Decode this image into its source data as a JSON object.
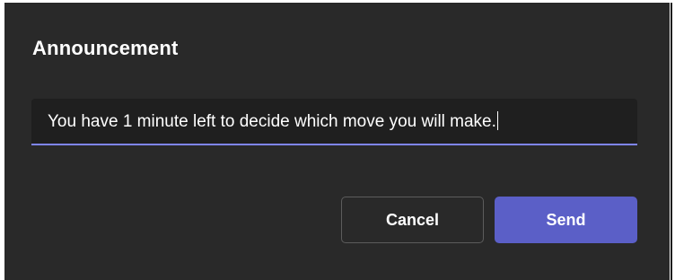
{
  "dialog": {
    "title": "Announcement",
    "input": {
      "value": "You have 1 minute left to decide which move you will make."
    },
    "buttons": {
      "cancel_label": "Cancel",
      "send_label": "Send"
    }
  },
  "colors": {
    "dialog_bg": "#292929",
    "input_bg": "#1f1f1f",
    "input_underline": "#7f85f5",
    "primary_button": "#5b5fc7",
    "secondary_border": "#5c5c5c"
  }
}
